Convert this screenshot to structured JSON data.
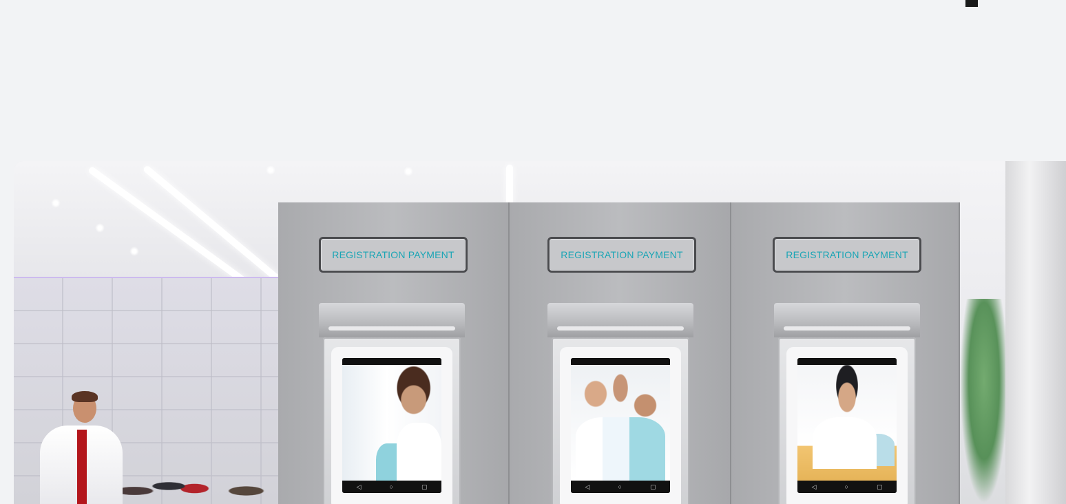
{
  "kiosks": [
    {
      "sign_label": "REGISTRATION   PAYMENT"
    },
    {
      "sign_label": "REGISTRATION   PAYMENT"
    },
    {
      "sign_label": "REGISTRATION   PAYMENT"
    }
  ],
  "icons": {
    "nav_back": "◁",
    "nav_home": "○",
    "nav_recent": "▢"
  }
}
